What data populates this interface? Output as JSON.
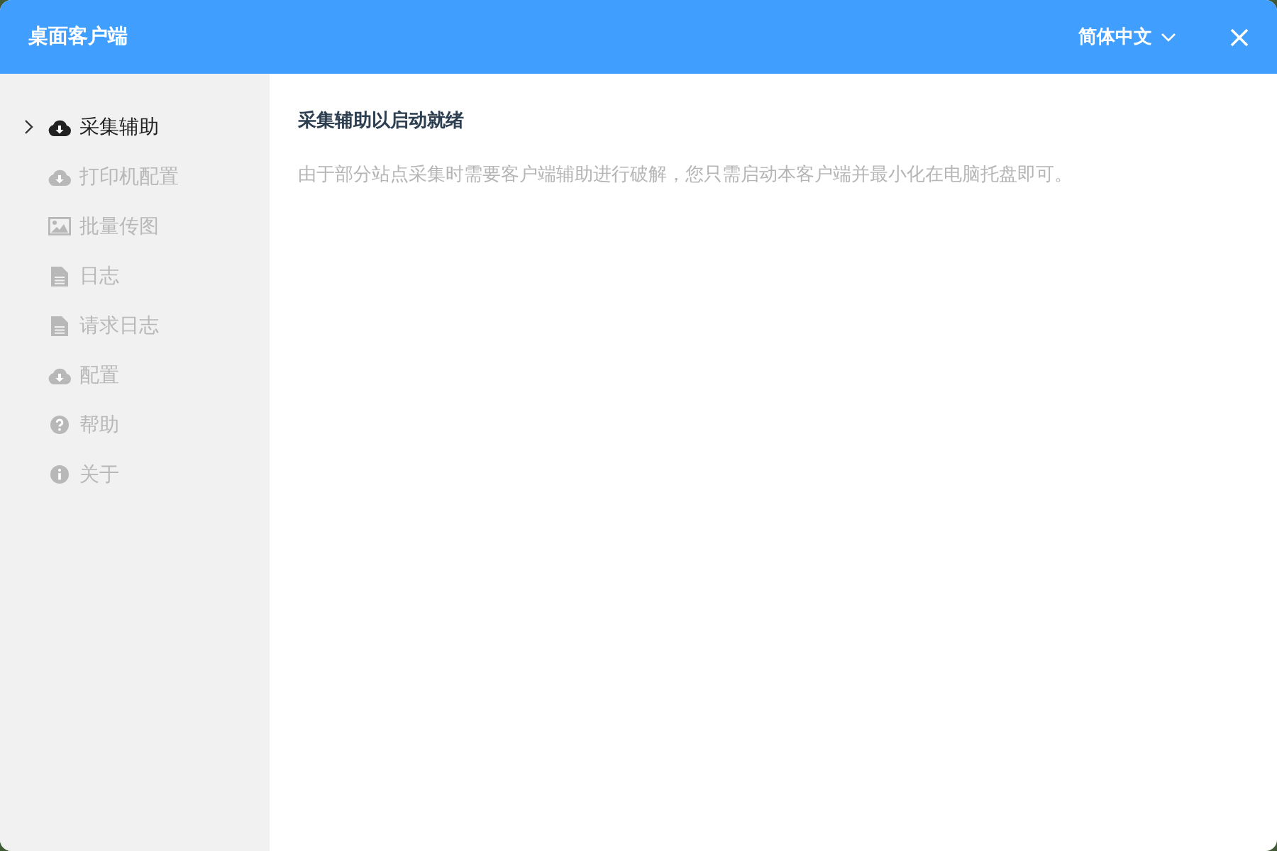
{
  "window": {
    "title": "桌面客户端",
    "language": "简体中文"
  },
  "sidebar": {
    "items": [
      {
        "label": "采集辅助",
        "kind": "cloud",
        "selected": true
      },
      {
        "label": "打印机配置",
        "kind": "cloud",
        "selected": false
      },
      {
        "label": "批量传图",
        "kind": "image",
        "selected": false
      },
      {
        "label": "日志",
        "kind": "file",
        "selected": false
      },
      {
        "label": "请求日志",
        "kind": "file",
        "selected": false
      },
      {
        "label": "配置",
        "kind": "cloud",
        "selected": false
      },
      {
        "label": "帮助",
        "kind": "question",
        "selected": false
      },
      {
        "label": "关于",
        "kind": "info",
        "selected": false
      }
    ]
  },
  "content": {
    "heading": "采集辅助以启动就绪",
    "text": "由于部分站点采集时需要客户端辅助进行破解，您只需启动本客户端并最小化在电脑托盘即可。"
  }
}
